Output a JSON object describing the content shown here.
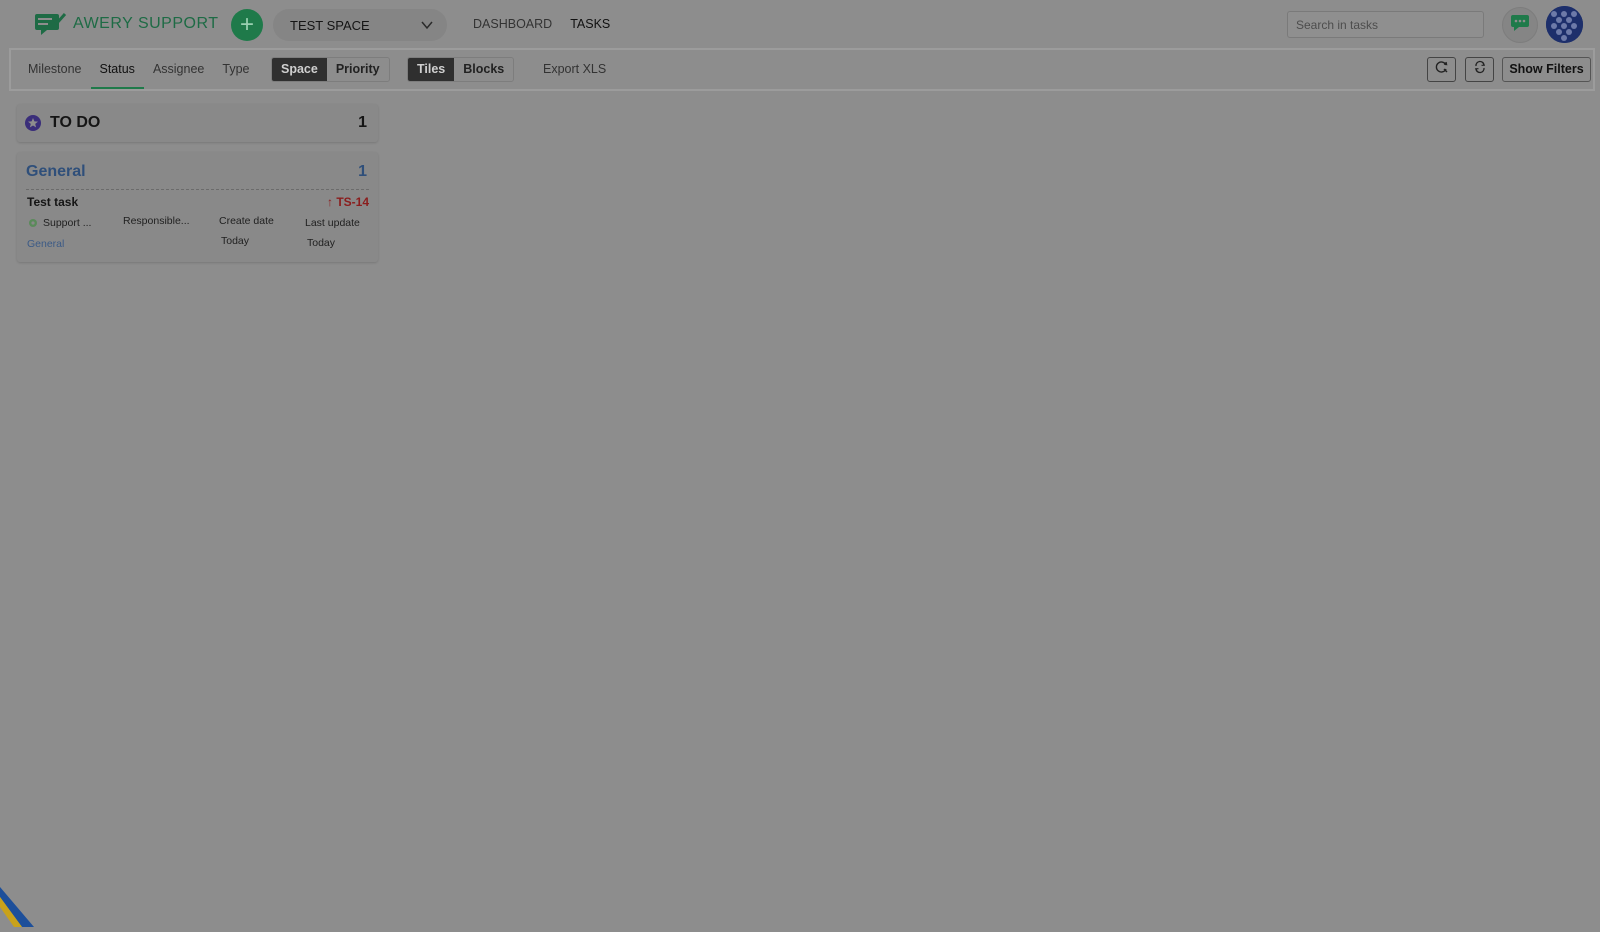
{
  "header": {
    "app_name": "AWERY SUPPORT",
    "space_selector": "TEST SPACE",
    "nav": [
      "DASHBOARD",
      "TASKS"
    ],
    "search_placeholder": "Search in tasks",
    "colors": {
      "brand": "#1f7a4a",
      "avatar": "#1d2f6b"
    }
  },
  "toolbar": {
    "tabs": [
      "Milestone",
      "Status",
      "Assignee",
      "Type"
    ],
    "active_tab": "Status",
    "group_by": [
      "Space",
      "Priority"
    ],
    "group_by_active": "Space",
    "view": [
      "Tiles",
      "Blocks"
    ],
    "view_active": "Tiles",
    "export_label": "Export XLS",
    "show_filters_label": "Show Filters"
  },
  "board": {
    "column": {
      "title": "TO DO",
      "count": "1",
      "icon": "star-circle-icon",
      "icon_color": "#3a2e7a"
    },
    "group": {
      "title": "General",
      "count": "1"
    },
    "task": {
      "title": "Test task",
      "key": "↑ TS-14",
      "space": "Support ...",
      "responsible": "Responsible...",
      "create_date_label": "Create date",
      "create_date": "Today",
      "last_update_label": "Last update",
      "last_update": "Today",
      "group": "General"
    }
  }
}
